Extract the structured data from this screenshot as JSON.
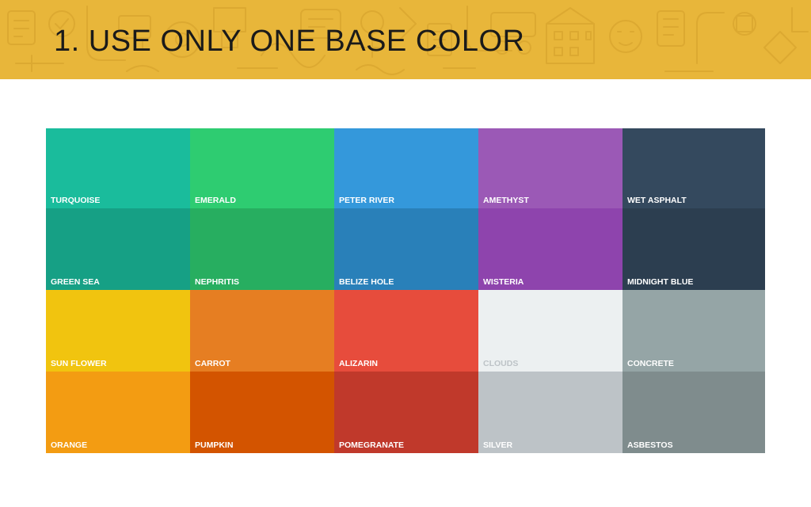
{
  "title": "1. USE ONLY ONE BASE COLOR",
  "header_color": "#E8B63A",
  "swatches": [
    {
      "name": "TURQUOISE",
      "color": "#1ABC9C",
      "label_color": "#FFFFFF"
    },
    {
      "name": "EMERALD",
      "color": "#2ECC71",
      "label_color": "#FFFFFF"
    },
    {
      "name": "PETER RIVER",
      "color": "#3498DB",
      "label_color": "#FFFFFF"
    },
    {
      "name": "AMETHYST",
      "color": "#9B59B6",
      "label_color": "#FFFFFF"
    },
    {
      "name": "WET ASPHALT",
      "color": "#34495E",
      "label_color": "#FFFFFF"
    },
    {
      "name": "GREEN SEA",
      "color": "#16A085",
      "label_color": "#FFFFFF"
    },
    {
      "name": "NEPHRITIS",
      "color": "#27AE60",
      "label_color": "#FFFFFF"
    },
    {
      "name": "BELIZE HOLE",
      "color": "#2980B9",
      "label_color": "#FFFFFF"
    },
    {
      "name": "WISTERIA",
      "color": "#8E44AD",
      "label_color": "#FFFFFF"
    },
    {
      "name": "MIDNIGHT BLUE",
      "color": "#2C3E50",
      "label_color": "#FFFFFF"
    },
    {
      "name": "SUN FLOWER",
      "color": "#F1C40F",
      "label_color": "#FFFFFF"
    },
    {
      "name": "CARROT",
      "color": "#E67E22",
      "label_color": "#FFFFFF"
    },
    {
      "name": "ALIZARIN",
      "color": "#E74C3C",
      "label_color": "#FFFFFF"
    },
    {
      "name": "CLOUDS",
      "color": "#ECF0F1",
      "label_color": "#BDC3C7"
    },
    {
      "name": "CONCRETE",
      "color": "#95A5A6",
      "label_color": "#FFFFFF"
    },
    {
      "name": "ORANGE",
      "color": "#F39C12",
      "label_color": "#FFFFFF"
    },
    {
      "name": "PUMPKIN",
      "color": "#D35400",
      "label_color": "#FFFFFF"
    },
    {
      "name": "POMEGRANATE",
      "color": "#C0392B",
      "label_color": "#FFFFFF"
    },
    {
      "name": "SILVER",
      "color": "#BDC3C7",
      "label_color": "#FFFFFF"
    },
    {
      "name": "ASBESTOS",
      "color": "#7F8C8D",
      "label_color": "#FFFFFF"
    }
  ]
}
